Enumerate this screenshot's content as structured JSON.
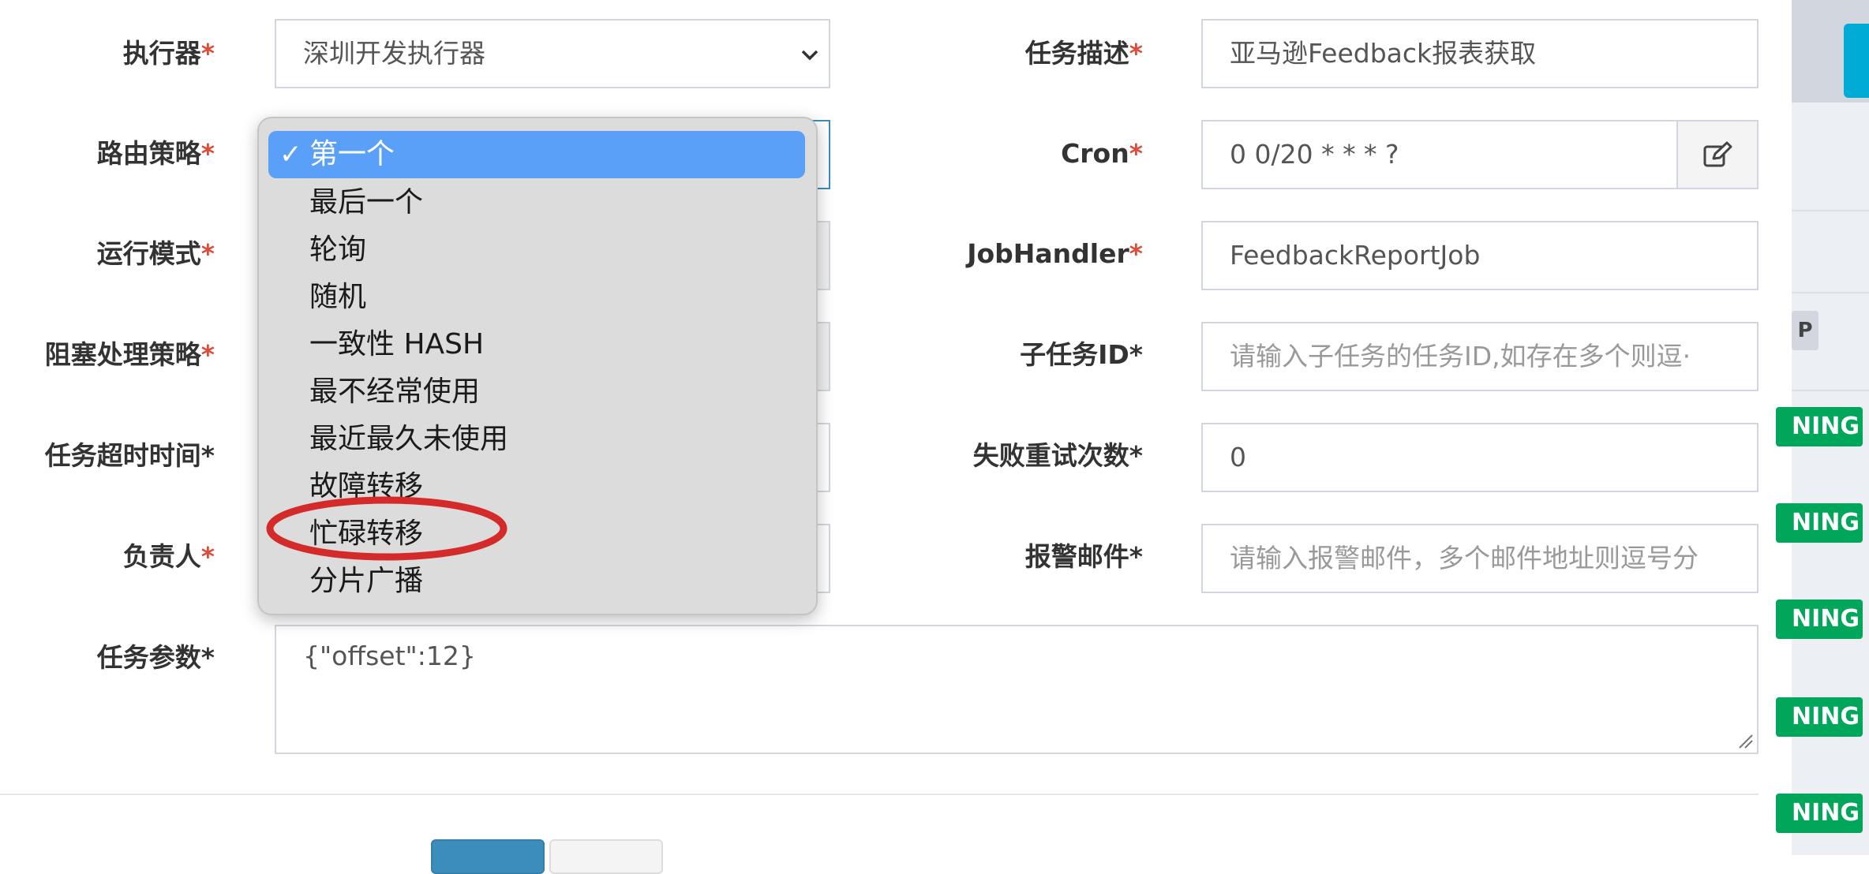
{
  "form": {
    "executor": {
      "label": "执行器",
      "value": "深圳开发执行器"
    },
    "route": {
      "label": "路由策略"
    },
    "run_mode": {
      "label": "运行模式"
    },
    "block_strategy": {
      "label": "阻塞处理策略"
    },
    "timeout": {
      "label": "任务超时时间*"
    },
    "owner": {
      "label": "负责人"
    },
    "params": {
      "label": "任务参数*",
      "value": "{\"offset\":12}"
    },
    "desc": {
      "label": "任务描述",
      "value": "亚马逊Feedback报表获取"
    },
    "cron": {
      "label": "Cron",
      "value": "0 0/20 * * * ?"
    },
    "jobhandler": {
      "label": "JobHandler",
      "value": "FeedbackReportJob"
    },
    "child_id": {
      "label": "子任务ID*",
      "placeholder": "请输入子任务的任务ID,如存在多个则逗·"
    },
    "retry": {
      "label": "失败重试次数*",
      "value": "0"
    },
    "alarm_email": {
      "label": "报警邮件*",
      "placeholder": "请输入报警邮件，多个邮件地址则逗号分"
    },
    "required_mark": "*"
  },
  "route_dropdown": {
    "selected": "第一个",
    "options": [
      "最后一个",
      "轮询",
      "随机",
      "一致性 HASH",
      "最不经常使用",
      "最近最久未使用",
      "故障转移",
      "忙碌转移",
      "分片广播"
    ],
    "highlighted": "忙碌转移",
    "highlight_color": "#d42a2a"
  },
  "sidebar": {
    "badge_text": "NING",
    "badge_color": "#00a65a",
    "partial_badge": "P"
  },
  "colors": {
    "required": "#dd4b39",
    "selected_option": "#5aa0f8"
  }
}
